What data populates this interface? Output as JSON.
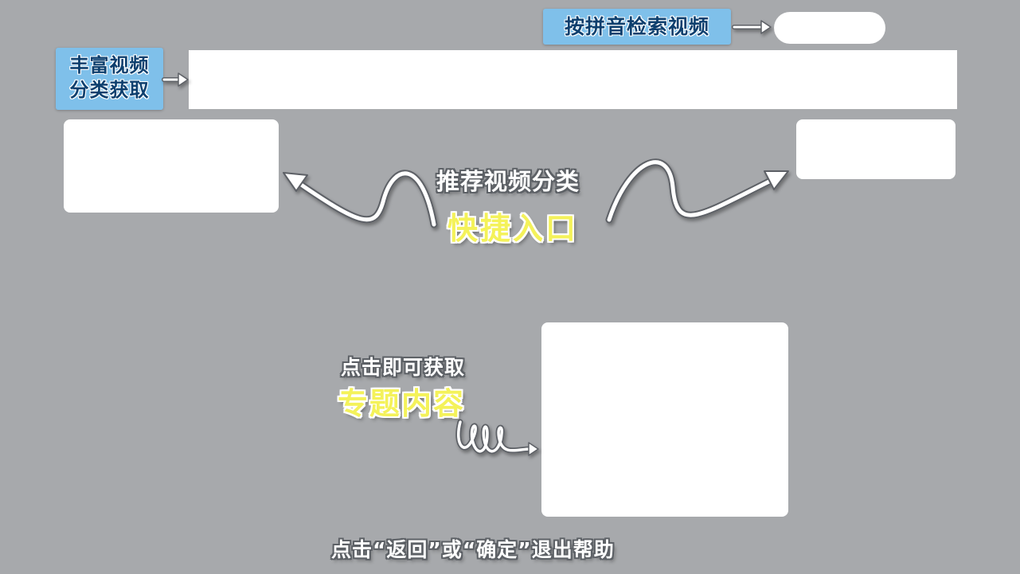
{
  "callouts": {
    "pinyin_search": "按拼音检索视频",
    "category_line1": "丰富视频",
    "category_line2": "分类获取"
  },
  "quick_entry": {
    "subtitle": "推荐视频分类",
    "title": "快捷入口"
  },
  "topic": {
    "subtitle": "点击即可获取",
    "title": "专题内容"
  },
  "footer": {
    "hint": "点击“返回”或“确定”退出帮助"
  },
  "colors": {
    "background": "#a7a9ac",
    "callout_bg": "#7fc0ea",
    "callout_text": "#0d3f6e",
    "highlight_yellow": "#f4f25a",
    "slot": "#ffffff"
  }
}
